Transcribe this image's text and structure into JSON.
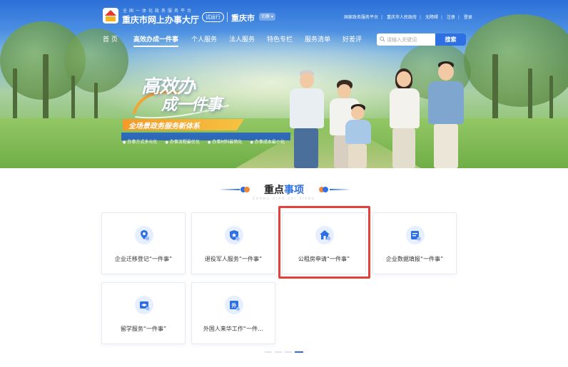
{
  "header": {
    "site_subtitle": "全国一体化政务服务平台",
    "site_title": "重庆市网上办事大厅",
    "trial_tag": "试运行",
    "city": "重庆市",
    "city_switch": "切换",
    "top_links": [
      "国家政务服务平台",
      "重庆市人民政府",
      "无障碍",
      "注册",
      "登录"
    ]
  },
  "nav": {
    "items": [
      {
        "label": "首  页",
        "active": false
      },
      {
        "label": "高效办成一件事",
        "active": true
      },
      {
        "label": "个人服务",
        "active": false
      },
      {
        "label": "法人服务",
        "active": false
      },
      {
        "label": "特色专栏",
        "active": false
      },
      {
        "label": "服务清单",
        "active": false
      },
      {
        "label": "好差评",
        "active": false
      }
    ],
    "search_placeholder": "请输入关键词",
    "search_button": "搜索"
  },
  "banner": {
    "slogan_line1": "高效办",
    "slogan_line2": "成一件事",
    "ribbon": "全场景政务服务新体系",
    "tags": [
      "办事方式多元化",
      "办事流程最优化",
      "办事材料最简化",
      "办事成本最小化"
    ]
  },
  "section": {
    "title_part1": "重点",
    "title_part2": "事项",
    "pinyin": "ZHONG DIAN SHI XIANG",
    "items": [
      {
        "label": "企业迁移登记“一件事”",
        "icon": "location-pin-icon"
      },
      {
        "label": "退役军人服务“一件事”",
        "icon": "star-shield-icon"
      },
      {
        "label": "公租房申请“一件事”",
        "icon": "house-icon"
      },
      {
        "label": "企业数据填报“一件事”",
        "icon": "form-report-icon"
      },
      {
        "label": "留学服务“一件事”",
        "icon": "graduation-cap-icon"
      },
      {
        "label": "外国人来华工作“一件…",
        "icon": "foreigner-icon"
      }
    ]
  },
  "colors": {
    "accent": "#2f6fe4",
    "highlight": "#e5413b",
    "icon_bg": "#e6efff"
  }
}
